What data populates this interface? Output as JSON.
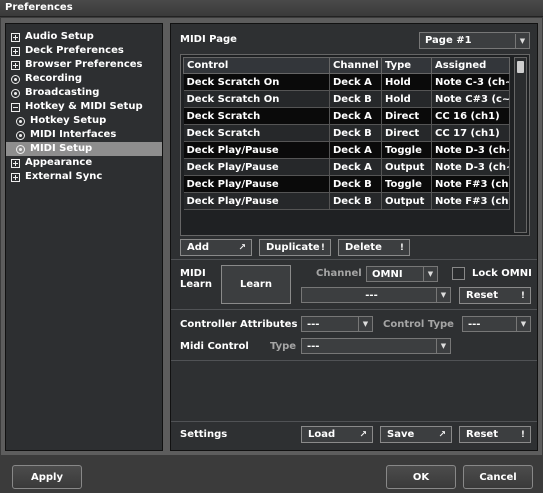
{
  "window": {
    "title": "Preferences"
  },
  "tree": {
    "items": [
      {
        "label": "Audio Setup",
        "kind": "plus",
        "indent": 0,
        "name": "tree-item-audio-setup",
        "icon": "expand-plus-icon"
      },
      {
        "label": "Deck Preferences",
        "kind": "plus",
        "indent": 0,
        "name": "tree-item-deck-preferences",
        "icon": "expand-plus-icon"
      },
      {
        "label": "Browser Preferences",
        "kind": "plus",
        "indent": 0,
        "name": "tree-item-browser-preferences",
        "icon": "expand-plus-icon"
      },
      {
        "label": "Recording",
        "kind": "radio",
        "indent": 0,
        "name": "tree-item-recording",
        "icon": "radio-dot-icon"
      },
      {
        "label": "Broadcasting",
        "kind": "radio",
        "indent": 0,
        "name": "tree-item-broadcasting",
        "icon": "radio-dot-icon"
      },
      {
        "label": "Hotkey & MIDI Setup",
        "kind": "minus",
        "indent": 0,
        "name": "tree-item-hotkey-midi-setup",
        "icon": "collapse-minus-icon"
      },
      {
        "label": "Hotkey Setup",
        "kind": "radio",
        "indent": 1,
        "name": "tree-item-hotkey-setup",
        "icon": "radio-dot-icon"
      },
      {
        "label": "MIDI Interfaces",
        "kind": "radio",
        "indent": 1,
        "name": "tree-item-midi-interfaces",
        "icon": "radio-dot-icon"
      },
      {
        "label": "MIDI Setup",
        "kind": "radio",
        "indent": 1,
        "selected": true,
        "name": "tree-item-midi-setup",
        "icon": "radio-dot-icon"
      },
      {
        "label": "Appearance",
        "kind": "plus",
        "indent": 0,
        "name": "tree-item-appearance",
        "icon": "expand-plus-icon"
      },
      {
        "label": "External Sync",
        "kind": "plus",
        "indent": 0,
        "name": "tree-item-external-sync",
        "icon": "expand-plus-icon"
      }
    ]
  },
  "midi_page": {
    "label": "MIDI Page",
    "value": "Page #1"
  },
  "table": {
    "columns": [
      "Control",
      "Channel",
      "Type",
      "Assigned"
    ],
    "rows": [
      [
        "Deck Scratch On",
        "Deck A",
        "Hold",
        "Note C-3 (ch~"
      ],
      [
        "Deck Scratch On",
        "Deck B",
        "Hold",
        "Note C#3 (c~"
      ],
      [
        "Deck Scratch",
        "Deck A",
        "Direct",
        "CC 16 (ch1)"
      ],
      [
        "Deck Scratch",
        "Deck B",
        "Direct",
        "CC 17 (ch1)"
      ],
      [
        "Deck Play/Pause",
        "Deck A",
        "Toggle",
        "Note D-3 (ch~"
      ],
      [
        "Deck Play/Pause",
        "Deck A",
        "Output",
        "Note D-3 (ch~"
      ],
      [
        "Deck Play/Pause",
        "Deck B",
        "Toggle",
        "Note F#3 (ch~"
      ],
      [
        "Deck Play/Pause",
        "Deck B",
        "Output",
        "Note F#3 (ch~"
      ]
    ]
  },
  "table_buttons": {
    "add": "Add",
    "duplicate": "Duplicate",
    "delete": "Delete"
  },
  "midi_learn": {
    "label_line1": "MIDI",
    "label_line2": "Learn",
    "learn_button": "Learn",
    "channel_label": "Channel",
    "channel_value": "OMNI",
    "lock_omni_label": "Lock OMNI",
    "learn_combo_value": "---",
    "reset_label": "Reset"
  },
  "controller": {
    "attributes_label": "Controller Attributes",
    "attributes_value": "---",
    "control_type_label": "Control Type",
    "control_type_value": "---",
    "midi_control_label": "Midi Control",
    "type_label": "Type",
    "type_value": "---"
  },
  "settings": {
    "label": "Settings",
    "load": "Load",
    "save": "Save",
    "reset": "Reset"
  },
  "footer": {
    "apply": "Apply",
    "ok": "OK",
    "cancel": "Cancel"
  },
  "colors": {
    "panel_bg": "#2e3032",
    "frame_bg": "#5d5d5d",
    "selected_bg": "#8e8e8e",
    "row_dark": "#0a0a0a"
  }
}
